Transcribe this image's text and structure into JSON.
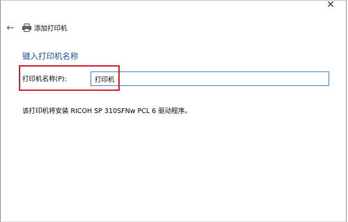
{
  "window": {
    "close_glyph": "✕"
  },
  "nav": {
    "back_glyph": "←",
    "title": "添加打印机"
  },
  "form": {
    "heading": "键入打印机名称",
    "name_label": "打印机名称(P):",
    "name_value": "打印机"
  },
  "info": {
    "driver_text": "该打印机将安装 RICOH SP 310SFNw PCL 6 驱动程序。"
  },
  "annotation": {
    "highlight_color": "#d0202a"
  }
}
